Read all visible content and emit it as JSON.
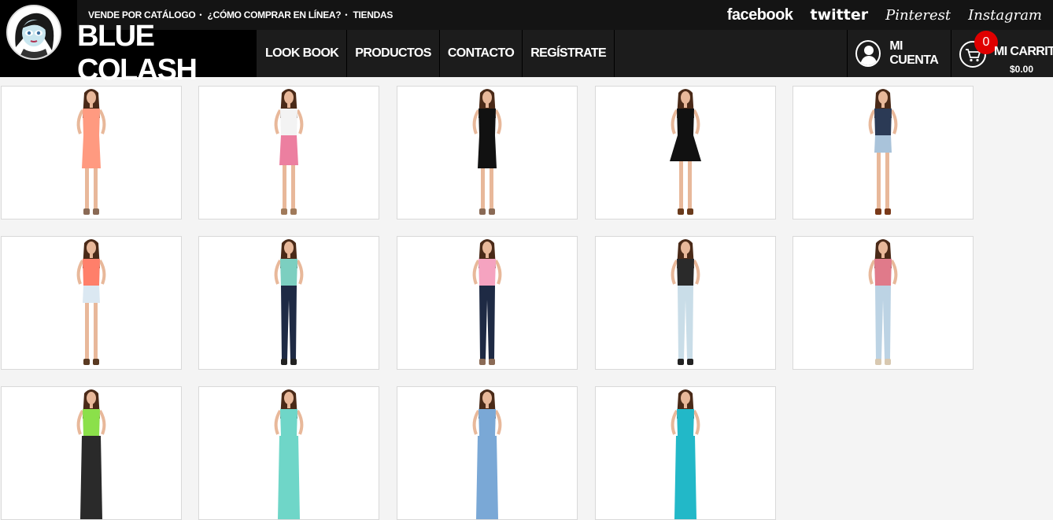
{
  "header": {
    "top_links": [
      {
        "label": "VENDE POR CATÁLOGO"
      },
      {
        "label": "¿CÓMO COMPRAR EN LÍNEA?"
      },
      {
        "label": "TIENDAS"
      }
    ],
    "social": {
      "facebook": "facebook",
      "twitter": "twitter",
      "pinterest": "Pinterest",
      "instagram": "Instagram"
    },
    "brand": "BLUE COLASH",
    "nav": [
      {
        "label": "LOOK BOOK"
      },
      {
        "label": "PRODUCTOS"
      },
      {
        "label": "CONTACTO"
      },
      {
        "label": "REGÍSTRATE"
      }
    ],
    "account_label": "MI CUENTA",
    "cart": {
      "label": "MI CARRITO",
      "count": "0",
      "total": "$0.00"
    }
  },
  "products": [
    {
      "icon": "model-coral-dress",
      "top": "#ff9a80",
      "bottom": "#ff9a80",
      "shoes": "#8a6a55",
      "style": "dress"
    },
    {
      "icon": "model-peplum-skirt",
      "top": "#f3f3f3",
      "bottom": "#ec7fa0",
      "shoes": "#a07a5a",
      "style": "skirt"
    },
    {
      "icon": "model-black-dress",
      "top": "#111111",
      "bottom": "#111111",
      "shoes": "#8a6a55",
      "style": "dress"
    },
    {
      "icon": "model-black-skater-dress",
      "top": "#111111",
      "bottom": "#111111",
      "shoes": "#6a3b1c",
      "style": "skater"
    },
    {
      "icon": "model-floral-denim-shorts",
      "top": "#2b3a55",
      "bottom": "#a9c3da",
      "shoes": "#7a3a1a",
      "style": "shorts"
    },
    {
      "icon": "model-coral-top-shorts",
      "top": "#ff7f6a",
      "bottom": "#dbe8f2",
      "shoes": "#5a3a22",
      "style": "shorts"
    },
    {
      "icon": "model-mint-stripe-jeans",
      "top": "#7ccfc0",
      "bottom": "#1e2a44",
      "shoes": "#222222",
      "style": "pants"
    },
    {
      "icon": "model-pink-crop-jeans",
      "top": "#f5a3c0",
      "bottom": "#1e2a44",
      "shoes": "#8a6a55",
      "style": "pants"
    },
    {
      "icon": "model-floral-top-lightjeans",
      "top": "#2a2a2a",
      "bottom": "#c9dde8",
      "shoes": "#222222",
      "style": "pants"
    },
    {
      "icon": "model-print-top-lightjeans",
      "top": "#e07a8a",
      "bottom": "#bcd3e4",
      "shoes": "#d8c8b0",
      "style": "pants"
    },
    {
      "icon": "model-neon-print-top",
      "top": "#8be04a",
      "bottom": "#2a2a2a",
      "shoes": "#222222",
      "style": "partial"
    },
    {
      "icon": "model-mint-dress",
      "top": "#6fd6c8",
      "bottom": "#6fd6c8",
      "shoes": "#8a6a55",
      "style": "partial"
    },
    {
      "icon": "model-denim-jacket",
      "top": "#7aa8d6",
      "bottom": "#7aa8d6",
      "shoes": "#222222",
      "style": "partial"
    },
    {
      "icon": "model-turquoise-top-vest",
      "top": "#22b8c8",
      "bottom": "#22b8c8",
      "shoes": "#222222",
      "style": "partial"
    }
  ]
}
